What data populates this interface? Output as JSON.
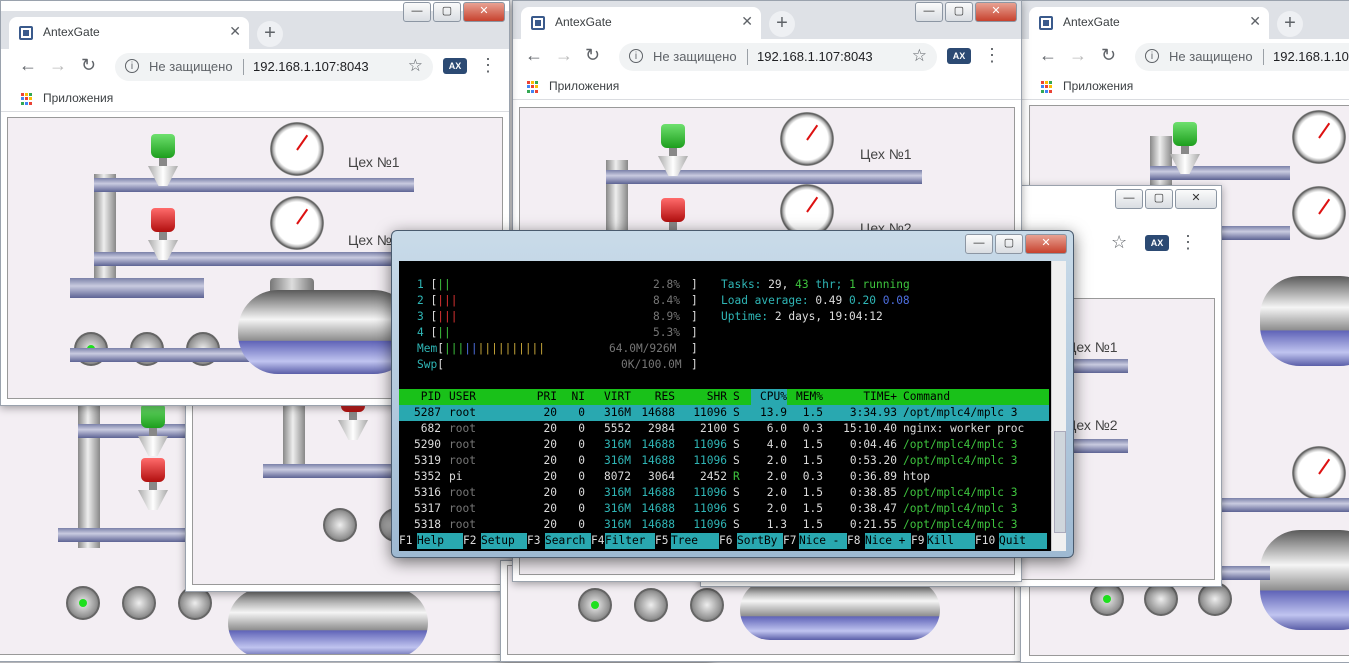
{
  "browser": {
    "tab_title": "AntexGate",
    "tab_close": "✕",
    "new_tab": "+",
    "not_secure": "Не защищено",
    "url": "192.168.1.107:8043",
    "bookmarks_label": "Приложения",
    "ext_label": "AX"
  },
  "scada": {
    "workshop1": "Цех №1",
    "workshop2": "Цех №2"
  },
  "htop": {
    "cpu_rows": [
      {
        "num": "1",
        "bar": "||",
        "pct": "2.8%"
      },
      {
        "num": "2",
        "bar": "|||",
        "pct": "8.4%"
      },
      {
        "num": "3",
        "bar": "|||",
        "pct": "8.9%"
      },
      {
        "num": "4",
        "bar": "||",
        "pct": "5.3%"
      }
    ],
    "mem_label": "Mem",
    "mem_bar": "||||||||||",
    "mem_value": "64.0M/926M",
    "swp_label": "Swp",
    "swp_value": "0K/100.0M",
    "tasks_label": "Tasks:",
    "tasks_value": "29,",
    "thr_value": "43",
    "thr_label": "thr;",
    "running_value": "1 running",
    "load_label": "Load average:",
    "load_1": "0.49",
    "load_5": "0.20",
    "load_15": "0.08",
    "uptime_label": "Uptime:",
    "uptime_value": "2 days, 19:04:12",
    "columns": [
      "PID",
      "USER",
      "PRI",
      "NI",
      "VIRT",
      "RES",
      "SHR",
      "S",
      "CPU%",
      "MEM%",
      "TIME+",
      "Command"
    ],
    "processes": [
      {
        "pid": "5287",
        "user": "root",
        "pri": "20",
        "ni": "0",
        "virt": "316M",
        "res": "14688",
        "shr": "11096",
        "s": "S",
        "cpu": "13.9",
        "mem": "1.5",
        "time": "3:34.93",
        "cmd": "/opt/mplc4/mplc 3"
      },
      {
        "pid": "682",
        "user": "root",
        "pri": "20",
        "ni": "0",
        "virt": "5552",
        "res": "2984",
        "shr": "2100",
        "s": "S",
        "cpu": "6.0",
        "mem": "0.3",
        "time": "15:10.40",
        "cmd": "nginx: worker proc"
      },
      {
        "pid": "5290",
        "user": "root",
        "pri": "20",
        "ni": "0",
        "virt": "316M",
        "res": "14688",
        "shr": "11096",
        "s": "S",
        "cpu": "4.0",
        "mem": "1.5",
        "time": "0:04.46",
        "cmd": "/opt/mplc4/mplc 3"
      },
      {
        "pid": "5319",
        "user": "root",
        "pri": "20",
        "ni": "0",
        "virt": "316M",
        "res": "14688",
        "shr": "11096",
        "s": "S",
        "cpu": "2.0",
        "mem": "1.5",
        "time": "0:53.20",
        "cmd": "/opt/mplc4/mplc 3"
      },
      {
        "pid": "5352",
        "user": "pi",
        "pri": "20",
        "ni": "0",
        "virt": "8072",
        "res": "3064",
        "shr": "2452",
        "s": "R",
        "cpu": "2.0",
        "mem": "0.3",
        "time": "0:36.89",
        "cmd": "htop"
      },
      {
        "pid": "5316",
        "user": "root",
        "pri": "20",
        "ni": "0",
        "virt": "316M",
        "res": "14688",
        "shr": "11096",
        "s": "S",
        "cpu": "2.0",
        "mem": "1.5",
        "time": "0:38.85",
        "cmd": "/opt/mplc4/mplc 3"
      },
      {
        "pid": "5317",
        "user": "root",
        "pri": "20",
        "ni": "0",
        "virt": "316M",
        "res": "14688",
        "shr": "11096",
        "s": "S",
        "cpu": "2.0",
        "mem": "1.5",
        "time": "0:38.47",
        "cmd": "/opt/mplc4/mplc 3"
      },
      {
        "pid": "5318",
        "user": "root",
        "pri": "20",
        "ni": "0",
        "virt": "316M",
        "res": "14688",
        "shr": "11096",
        "s": "S",
        "cpu": "1.3",
        "mem": "1.5",
        "time": "0:21.55",
        "cmd": "/opt/mplc4/mplc 3"
      }
    ],
    "fkeys": [
      {
        "key": "F1",
        "label": "Help"
      },
      {
        "key": "F2",
        "label": "Setup"
      },
      {
        "key": "F3",
        "label": "Search"
      },
      {
        "key": "F4",
        "label": "Filter"
      },
      {
        "key": "F5",
        "label": "Tree"
      },
      {
        "key": "F6",
        "label": "SortBy"
      },
      {
        "key": "F7",
        "label": "Nice -"
      },
      {
        "key": "F8",
        "label": "Nice +"
      },
      {
        "key": "F9",
        "label": "Kill"
      },
      {
        "key": "F10",
        "label": "Quit"
      }
    ]
  },
  "colors": {
    "htop_header": "#19c119",
    "htop_selected": "#29a8b0",
    "valve_open": "#1d9e1d",
    "valve_closed": "#b10f0f",
    "pipe": "#7a80a8"
  }
}
